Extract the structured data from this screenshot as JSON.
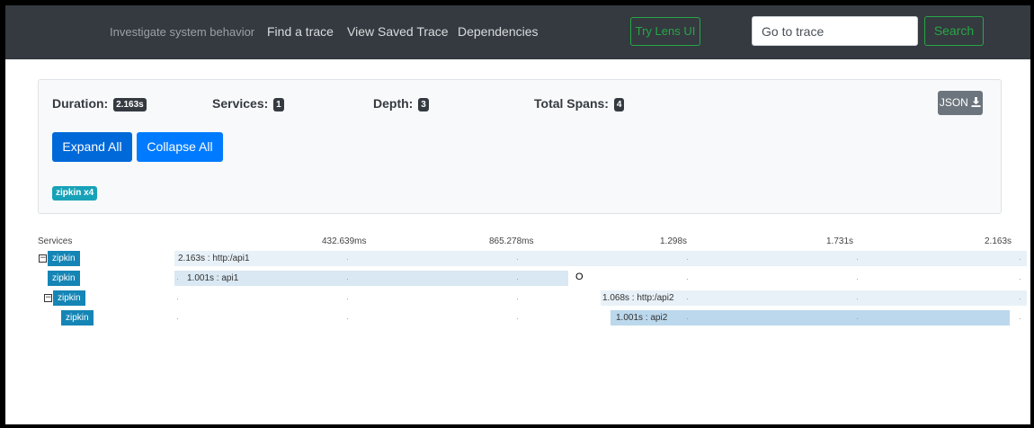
{
  "navbar": {
    "tagline": "Investigate system behavior",
    "links": [
      "Find a trace",
      "View Saved Trace",
      "Dependencies"
    ],
    "lens_button": "Try Lens UI",
    "goto_placeholder": "Go to trace",
    "search_button": "Search"
  },
  "summary": {
    "duration_label": "Duration:",
    "duration_value": "2.163s",
    "services_label": "Services:",
    "services_value": "1",
    "depth_label": "Depth:",
    "depth_value": "3",
    "total_spans_label": "Total Spans:",
    "total_spans_value": "4",
    "json_button": "JSON",
    "expand_button": "Expand All",
    "collapse_button": "Collapse All",
    "service_badge": "zipkin x4"
  },
  "timeline": {
    "header": "Services",
    "ticks": [
      "432.639ms",
      "865.278ms",
      "1.298s",
      "1.731s",
      "2.163s"
    ],
    "rows": [
      {
        "service": "zipkin",
        "label": "2.163s : http:/api1",
        "collapsible": true
      },
      {
        "service": "zipkin",
        "label": "1.001s : api1",
        "collapsible": false
      },
      {
        "service": "zipkin",
        "label": "1.068s : http:/api2",
        "collapsible": true
      },
      {
        "service": "zipkin",
        "label": "1.001s : api2",
        "collapsible": false
      }
    ]
  },
  "colors": {
    "navbar": "#343a40",
    "success": "#28a745",
    "primary": "#007bff",
    "service_label": "#1585b5",
    "span_bar": "#d9e8f2",
    "span_bar_selected": "#bcd8ec"
  }
}
